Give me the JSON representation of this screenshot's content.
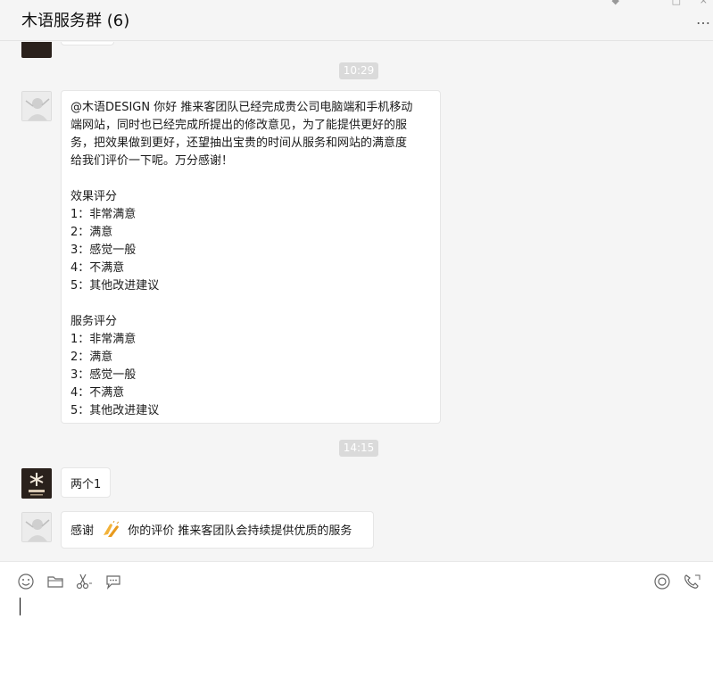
{
  "window": {
    "title": "木语服务群 (6)",
    "more_label": "…"
  },
  "chat": {
    "timestamps": [
      "10:29",
      "14:15"
    ],
    "messages": [
      {
        "sender": "photo-avatar",
        "lines": [
          "@木语DESIGN  你好 推来客团队已经完成贵公司电脑端和手机移动",
          "端网站，同时也已经完成所提出的修改意见，为了能提供更好的服",
          "务，把效果做到更好，还望抽出宝贵的时间从服务和网站的满意度",
          "给我们评价一下呢。万分感谢！",
          "",
          "效果评分",
          "1：非常满意",
          "2：满意",
          "3：感觉一般",
          "4：不满意",
          "5：其他改进建议",
          "",
          "服务评分",
          "1：非常满意",
          "2：满意",
          "3：感觉一般",
          "4：不满意",
          "5：其他改进建议"
        ]
      },
      {
        "sender": "logo-avatar",
        "text": "两个1"
      },
      {
        "sender": "photo-avatar",
        "text_before": "感谢",
        "text_after": "你的评价  推来客团队会持续提供优质的服务"
      }
    ]
  },
  "composer": {
    "tools": [
      "emoji-icon",
      "folder-icon",
      "scissors-icon",
      "chat-bubble-icon"
    ],
    "right_tools": [
      "screen-share-icon",
      "call-icon"
    ]
  },
  "colors": {
    "bg": "#f5f5f5",
    "bubble": "#ffffff",
    "timestamp_bg": "#dadada"
  }
}
